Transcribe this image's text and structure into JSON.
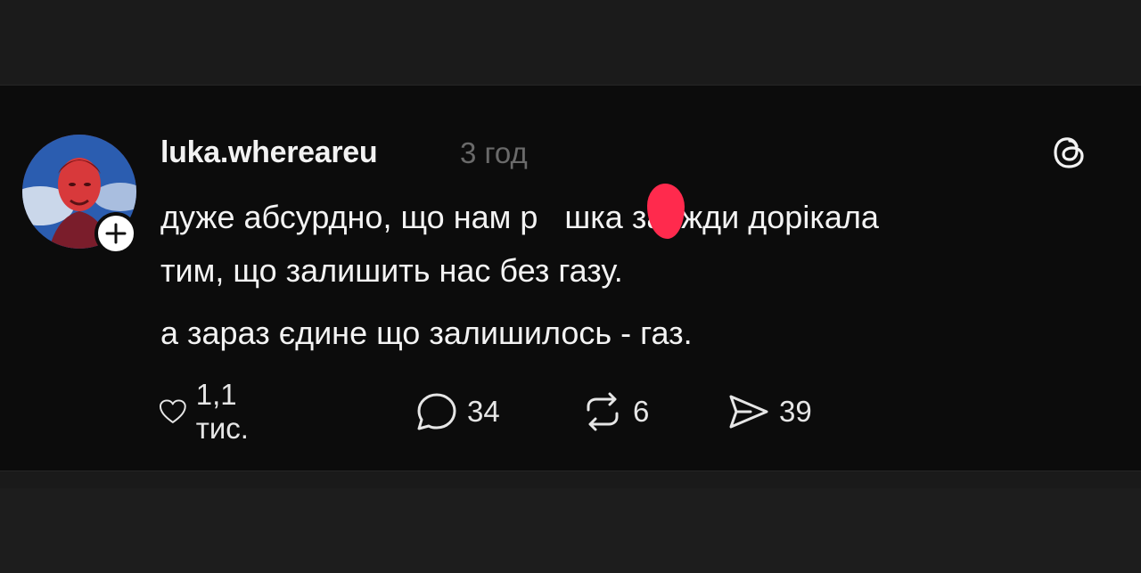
{
  "post": {
    "author": {
      "username": "luka.whereareu",
      "timestamp": "3 год"
    },
    "text": {
      "line1_before": "дуже абсурдно, що нам р",
      "line1_after": "шка завжди дорікала",
      "line2": "тим, що залишить нас без газу.",
      "line3": "а зараз єдине що залишилось - газ."
    },
    "actions": {
      "likes": "1,1 тис.",
      "replies": "34",
      "reposts": "6",
      "shares": "39"
    }
  },
  "icons": {
    "app_logo": "threads-icon",
    "like": "heart-icon",
    "reply": "comment-icon",
    "repost": "repost-icon",
    "share": "send-icon",
    "follow": "plus-icon"
  },
  "colors": {
    "background": "#0c0c0c",
    "text": "#f3f3f3",
    "secondary": "#6a6a6a",
    "redaction": "#ff2a4d"
  }
}
